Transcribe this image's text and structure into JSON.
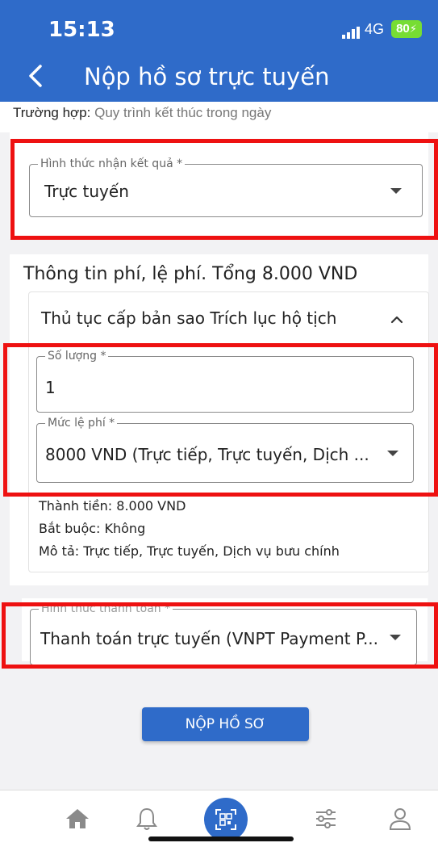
{
  "status_bar": {
    "time": "15:13",
    "network": "4G",
    "battery": "80"
  },
  "header": {
    "title": "Nộp hồ sơ trực tuyến",
    "back_icon": "chevron-left-icon"
  },
  "case_info": {
    "label": "Trường hợp:",
    "value": "Quy trình kết thúc trong ngày"
  },
  "result_method": {
    "legend": "Hình thức nhận kết quả *",
    "value": "Trực tuyến"
  },
  "fees": {
    "section_title": "Thông tin phí, lệ phí. Tổng 8.000 VND",
    "procedure_title": "Thủ tục cấp bản sao Trích lục hộ tịch",
    "quantity": {
      "legend": "Số lượng *",
      "value": "1"
    },
    "fee_level": {
      "legend": "Mức lệ phí *",
      "value": "8000 VND (Trực tiếp, Trực tuyến, Dịch ..."
    },
    "amount": "Thành tiền: 8.000 VND",
    "required": "Bắt buộc: Không",
    "description": "Mô tả: Trực tiếp, Trực tuyến, Dịch vụ bưu chính"
  },
  "payment": {
    "legend": "Hình thức thanh toán *",
    "value": "Thanh toán trực tuyến (VNPT Payment P..."
  },
  "submit_label": "NỘP HỒ SƠ",
  "nav_icons": [
    "home-icon",
    "bell-icon",
    "qr-code-icon",
    "sliders-icon",
    "user-icon"
  ],
  "colors": {
    "primary": "#2f6bc9",
    "highlight": "#ee1111",
    "battery": "#77dd33"
  }
}
